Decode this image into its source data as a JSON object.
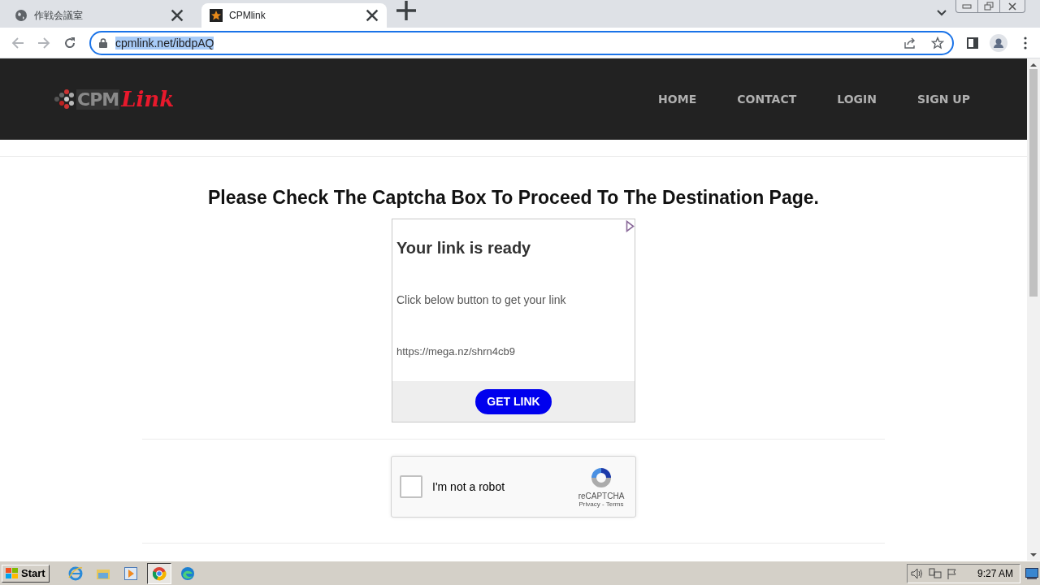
{
  "browser": {
    "tabs": [
      {
        "title": "作戦会議室",
        "selected": false
      },
      {
        "title": "CPMlink",
        "selected": true
      }
    ],
    "address": "cpmlink.net/ibdpAQ"
  },
  "site": {
    "logo": {
      "mark": "CPM",
      "word": "Link"
    },
    "nav": [
      "HOME",
      "CONTACT",
      "LOGIN",
      "SIGN UP"
    ]
  },
  "heading": "Please Check The Captcha Box To Proceed To The Destination Page.",
  "ad": {
    "title": "Your link is ready",
    "text": "Click below button to get your link",
    "url": "https://mega.nz/shrn4cb9",
    "button": "GET LINK"
  },
  "captcha": {
    "checked": false,
    "label": "I'm not a robot",
    "brand": "reCAPTCHA",
    "legal": "Privacy - Terms"
  },
  "taskbar": {
    "start": "Start",
    "clock": "9:27 AM"
  }
}
